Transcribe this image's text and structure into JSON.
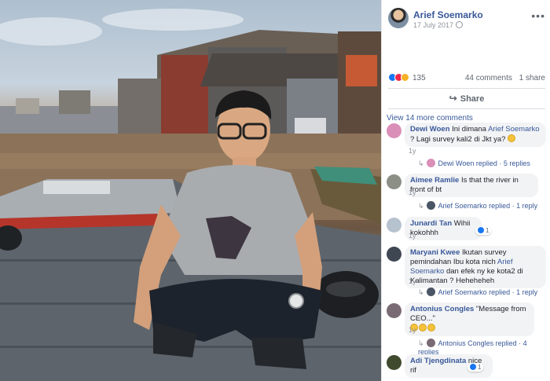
{
  "post": {
    "author": "Arief Soemarko",
    "date": "17 July 2017",
    "more_icon": "more-dots-icon",
    "reactions_count": "135",
    "comments_count": "44 comments",
    "shares_count": "1 share",
    "share_label": "Share",
    "view_more": "View 14 more comments"
  },
  "comments": [
    {
      "name": "Dewi Woen",
      "text_before": " Ini dimana ",
      "mention": "Arief Soemarko",
      "text_after": " ? Lagi survey kali2 di Jkt ya? ",
      "emoji_count": 1,
      "time": "1y",
      "reply": "Dewi Woen replied · 5 replies"
    },
    {
      "name": "Aimee Ramlie",
      "text_before": " Is that the river in front of bt",
      "time": "1y",
      "reply": "Arief Soemarko replied · 1 reply"
    },
    {
      "name": "Junardi Tan",
      "text_before": " Wihii kokohhh",
      "time": "1y",
      "likes": "1"
    },
    {
      "name": "Maryani Kwee",
      "text_before": " Ikutan survey pemindahan Ibu kota nich ",
      "mention": "Arief Soemarko",
      "text_after": " dan efek ny ke kota2 di Kalimantan ? Heheheheh",
      "time": "1y",
      "reply": "Arief Soemarko replied · 1 reply"
    },
    {
      "name": "Antonius Congles",
      "text_before": " \"Message from CEO...\"",
      "emoji_count": 3,
      "time": "1y",
      "reply": "Antonius Congles replied · 4 replies"
    },
    {
      "name": "Adi Tjengdinata",
      "text_before": " nice rif",
      "likes": "1"
    }
  ],
  "colors": {
    "link": "#385898",
    "bubble": "#f2f3f5",
    "like": "#1877f2",
    "love": "#f0284a",
    "haha": "#f7b125"
  }
}
